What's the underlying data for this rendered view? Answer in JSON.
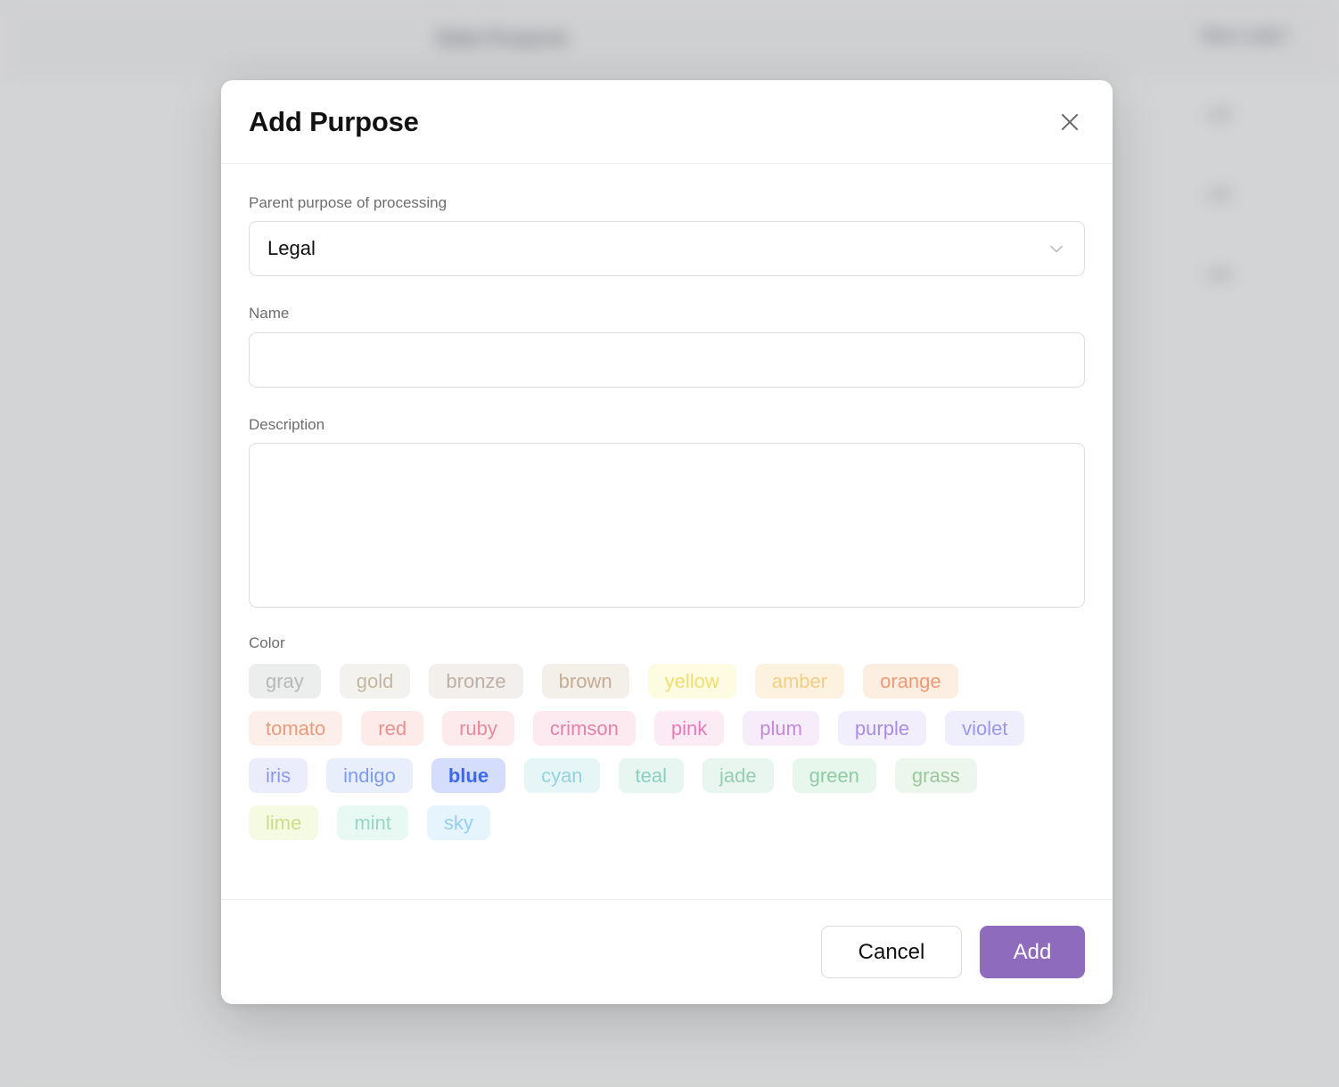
{
  "background": {
    "title": "Data Purpose",
    "action_label": "New Label",
    "rows": [
      {
        "cell": "edit"
      },
      {
        "cell": "edit"
      },
      {
        "cell": "edit"
      }
    ]
  },
  "dialog": {
    "title": "Add Purpose",
    "close_icon": "close-icon",
    "parent_purpose": {
      "label": "Parent purpose of processing",
      "value": "Legal",
      "chevron_icon": "chevron-down-icon"
    },
    "name": {
      "label": "Name",
      "value": "",
      "placeholder": ""
    },
    "description": {
      "label": "Description",
      "value": "",
      "placeholder": ""
    },
    "color": {
      "label": "Color",
      "selected": "blue",
      "options": [
        {
          "name": "gray",
          "bg": "#eceded",
          "fg": "#b6b8ba"
        },
        {
          "name": "gold",
          "bg": "#f4f2ee",
          "fg": "#c2b79f"
        },
        {
          "name": "bronze",
          "bg": "#f2efec",
          "fg": "#c0b0a6"
        },
        {
          "name": "brown",
          "bg": "#f3efe9",
          "fg": "#c5ad94"
        },
        {
          "name": "yellow",
          "bg": "#fdfbe2",
          "fg": "#f4dd70"
        },
        {
          "name": "amber",
          "bg": "#fdf2df",
          "fg": "#f3ce84"
        },
        {
          "name": "orange",
          "bg": "#fdeee2",
          "fg": "#ef9b75"
        },
        {
          "name": "tomato",
          "bg": "#fcefe9",
          "fg": "#ec9a7e"
        },
        {
          "name": "red",
          "bg": "#fdebea",
          "fg": "#e8908c"
        },
        {
          "name": "ruby",
          "bg": "#fdeaed",
          "fg": "#e78b9c"
        },
        {
          "name": "crimson",
          "bg": "#fdeaf1",
          "fg": "#e581a8"
        },
        {
          "name": "pink",
          "bg": "#fcebf4",
          "fg": "#e47cb8"
        },
        {
          "name": "plum",
          "bg": "#f7edfa",
          "fg": "#c389d6"
        },
        {
          "name": "purple",
          "bg": "#f2eefc",
          "fg": "#a98fe0"
        },
        {
          "name": "violet",
          "bg": "#eeeefd",
          "fg": "#9b99ea"
        },
        {
          "name": "iris",
          "bg": "#ebedfd",
          "fg": "#8f9aec"
        },
        {
          "name": "indigo",
          "bg": "#e9eefd",
          "fg": "#7f9bef"
        },
        {
          "name": "blue",
          "bg": "#d4ddfc",
          "fg": "#3d6ae8"
        },
        {
          "name": "cyan",
          "bg": "#e6f6f7",
          "fg": "#95d3e0"
        },
        {
          "name": "teal",
          "bg": "#e7f6f1",
          "fg": "#8ccfc0"
        },
        {
          "name": "jade",
          "bg": "#e8f6ef",
          "fg": "#96cdb4"
        },
        {
          "name": "green",
          "bg": "#e7f7ec",
          "fg": "#90cba3"
        },
        {
          "name": "grass",
          "bg": "#ecf6ed",
          "fg": "#9bc79e"
        },
        {
          "name": "lime",
          "bg": "#f5fae3",
          "fg": "#cbdd87"
        },
        {
          "name": "mint",
          "bg": "#e8f8f2",
          "fg": "#97d8c6"
        },
        {
          "name": "sky",
          "bg": "#e6f5fd",
          "fg": "#93cff1"
        }
      ]
    },
    "footer": {
      "cancel_label": "Cancel",
      "add_label": "Add",
      "add_button_color": "#8f6bbd"
    }
  }
}
